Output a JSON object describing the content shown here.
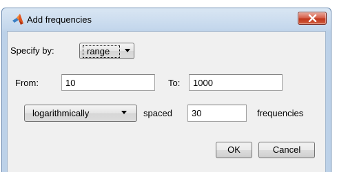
{
  "window": {
    "title": "Add frequencies"
  },
  "specify": {
    "label": "Specify by:",
    "selected": "range"
  },
  "range": {
    "from_label": "From:",
    "from_value": "10",
    "to_label": "To:",
    "to_value": "1000"
  },
  "spacing": {
    "mode": "logarithmically",
    "spaced_label": "spaced",
    "count": "30",
    "frequencies_label": "frequencies"
  },
  "buttons": {
    "ok": "OK",
    "cancel": "Cancel"
  },
  "icons": {
    "app": "matlab-logo-icon",
    "close": "close-icon",
    "dropdown": "chevron-down-icon"
  }
}
